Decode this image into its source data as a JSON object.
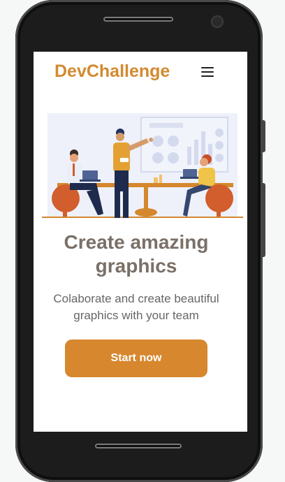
{
  "brand": {
    "name": "DevChallenge",
    "color": "#d38a30"
  },
  "nav": {
    "menu_icon": "hamburger-menu-icon"
  },
  "hero": {
    "illustration": "team-meeting-illustration",
    "headline": "Create amazing graphics",
    "subtitle": "Colaborate and create beautiful graphics with your team",
    "cta_label": "Start now",
    "cta_color": "#d7872e"
  }
}
